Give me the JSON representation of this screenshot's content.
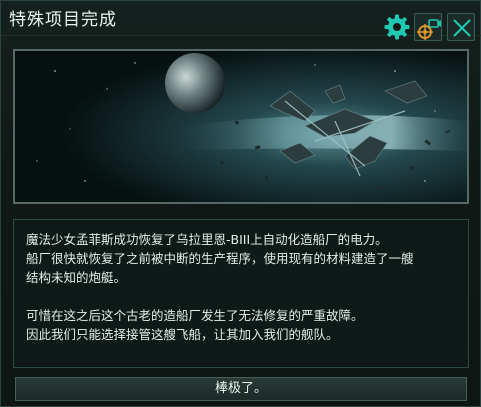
{
  "dialog": {
    "title": "特殊项目完成",
    "icons": {
      "settings": "gear-icon",
      "camera": "camera-target-icon",
      "close": "close-icon"
    },
    "accent_color": "#1fc9b3",
    "camera_color": "#e89a2c",
    "paragraph1_line1": "魔法少女孟菲斯成功恢复了乌拉里恩-BIII上自动化造船厂的电力。",
    "paragraph1_line2": "船厂很快就恢复了之前被中断的生产程序，使用现有的材料建造了一艘",
    "paragraph1_line3": "结构未知的炮艇。",
    "paragraph2_line1": "可惜在这之后这个古老的造船厂发生了无法修复的严重故障。",
    "paragraph2_line2": "因此我们只能选择接管这艘飞船，让其加入我们的舰队。",
    "confirm_label": "棒极了。"
  }
}
